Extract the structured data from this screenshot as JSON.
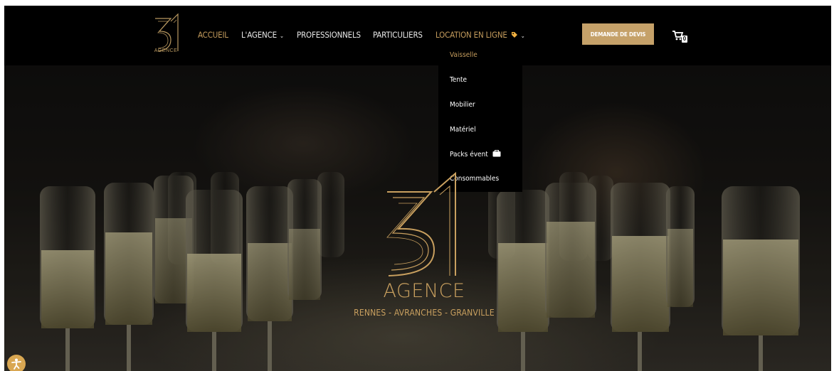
{
  "brand": {
    "logo_caption": "AGENCE",
    "center_title": "AGENCE",
    "center_cities": "RENNES - AVRANCHES - GRANVILLE"
  },
  "nav": {
    "accueil": "ACCUEIL",
    "agence": "L'AGENCE",
    "professionnels": "PROFESSIONNELS",
    "particuliers": "PARTICULIERS",
    "location": "LOCATION EN LIGNE"
  },
  "cta_label": "DEMANDE DE DEVIS",
  "cart_count": "0",
  "dropdown": {
    "items": [
      "Vaisselle",
      "Tente",
      "Mobilier",
      "Matériel",
      "Packs évent",
      "Consommables"
    ]
  },
  "icons": {
    "tag": "tag-icon",
    "chevron": "chevron-down-icon",
    "cart": "cart-icon",
    "packs": "box-icon",
    "badge": "accessibility-icon"
  },
  "colors": {
    "accent": "#c39b5c",
    "button": "#c5a169",
    "header": "#000000",
    "tag": "#f0b040"
  }
}
